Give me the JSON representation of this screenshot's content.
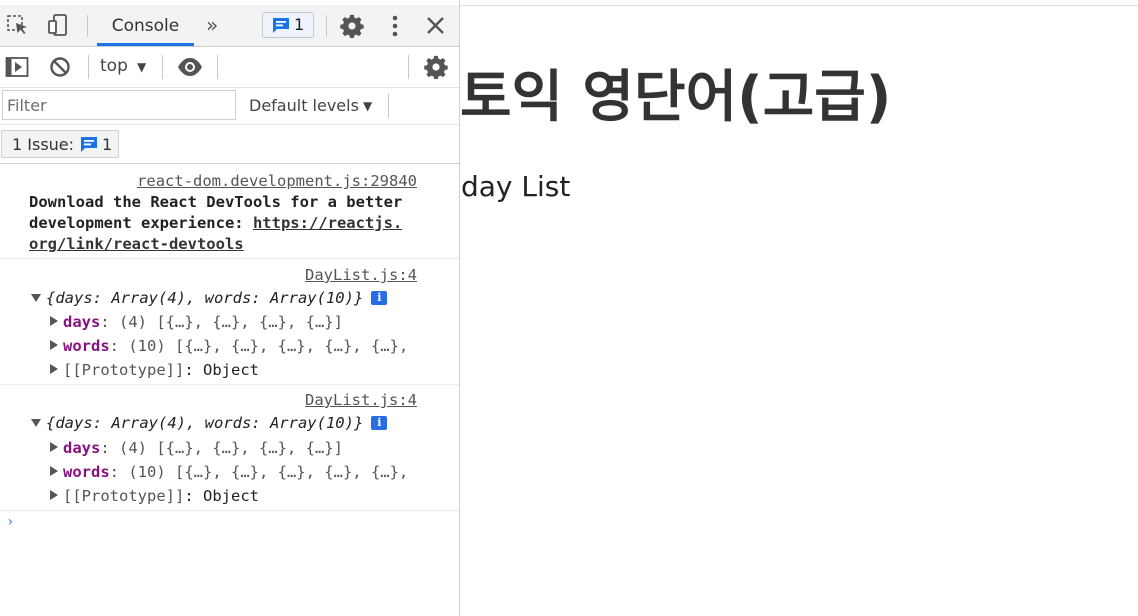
{
  "devtools": {
    "tabbar": {
      "active_tab": "Console",
      "more_tabs": "»",
      "issues_count": "1"
    },
    "toolbar": {
      "context": "top",
      "context_arrow": "▼"
    },
    "filter": {
      "placeholder": "Filter",
      "levels_label": "Default levels",
      "levels_arrow": "▼"
    },
    "issues_bar": {
      "label": "1 Issue:",
      "count": "1"
    },
    "messages": [
      {
        "source": "react-dom.development.js:29840",
        "lines": [
          "Download the React DevTools for a better",
          "development experience: ",
          "https://reactjs.",
          "org/link/react-devtools"
        ]
      },
      {
        "source": "DayList.js:4",
        "summary": "{days: Array(4), words: Array(10)}",
        "props": [
          {
            "key": "days",
            "value": ": (4) [{…}, {…}, {…}, {…}]"
          },
          {
            "key": "words",
            "value": ": (10) [{…}, {…}, {…}, {…}, {…},"
          },
          {
            "key": "[[Prototype]]",
            "value": ": Object"
          }
        ]
      },
      {
        "source": "DayList.js:4",
        "summary": "{days: Array(4), words: Array(10)}",
        "props": [
          {
            "key": "days",
            "value": ": (4) [{…}, {…}, {…}, {…}]"
          },
          {
            "key": "words",
            "value": ": (10) [{…}, {…}, {…}, {…}, {…},"
          },
          {
            "key": "[[Prototype]]",
            "value": ": Object"
          }
        ]
      }
    ],
    "prompt": "›",
    "info_badge": "i"
  },
  "page": {
    "title": "토익 영단어(고급)",
    "subtitle": "day List"
  },
  "colors": {
    "accent": "#1a73e8",
    "key_purple": "#881280",
    "toolbar_bg": "#f1f3f4"
  }
}
